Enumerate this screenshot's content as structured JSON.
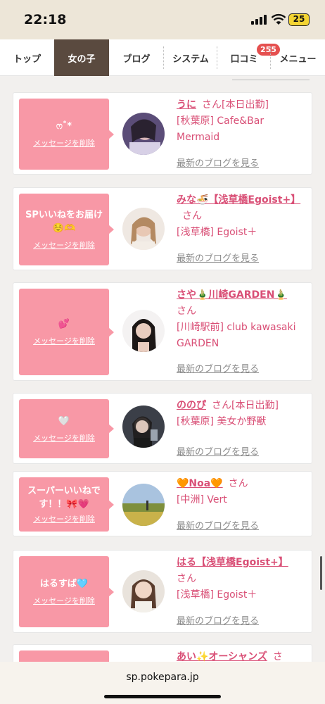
{
  "status_bar": {
    "time": "22:18",
    "battery": "25"
  },
  "nav": {
    "items": [
      {
        "label": "トップ"
      },
      {
        "label": "女の子"
      },
      {
        "label": "ブログ"
      },
      {
        "label": "システム"
      },
      {
        "label": "口コミ",
        "badge": "255"
      },
      {
        "label": "メニュー"
      }
    ],
    "active": "女の子"
  },
  "cards": [
    {
      "message": "ෆ˚*",
      "delete_label": "メッセージを削除",
      "name": "うに",
      "san": "さん",
      "status": "[本日出勤]",
      "shop": "[秋葉原] Cafe&Bar Mermaid",
      "blog_link": "最新のブログを見る"
    },
    {
      "message": "SPいいねをお届け☺️🫶",
      "delete_label": "メッセージを削除",
      "name": "みな🍜【浅草橋Egoist+】",
      "san": "さん",
      "status": "",
      "shop": "[浅草橋] Egoist＋",
      "blog_link": "最新のブログを見る"
    },
    {
      "message": "💕",
      "delete_label": "メッセージを削除",
      "name": "さや🎍川崎GARDEN🎍",
      "san": "さん",
      "status": "",
      "shop": "[川崎駅前] club kawasaki GARDEN",
      "blog_link": "最新のブログを見る"
    },
    {
      "message": "🤍",
      "delete_label": "メッセージを削除",
      "name": "ののぴ",
      "san": "さん",
      "status": "[本日出勤]",
      "shop": "[秋葉原] 美女か野獣",
      "blog_link": "最新のブログを見る"
    },
    {
      "message": "スーパーいいねです！！🎀💗",
      "delete_label": "メッセージを削除",
      "name": "🧡Noa🧡",
      "san": "さん",
      "status": "",
      "shop": "[中洲] Vert",
      "blog_link": "最新のブログを見る"
    },
    {
      "message": "はるすば🩵",
      "delete_label": "メッセージを削除",
      "name": "はる【浅草橋Egoist+】",
      "san": "さん",
      "status": "",
      "shop": "[浅草橋] Egoist＋",
      "blog_link": "最新のブログを見る"
    },
    {
      "message": "",
      "delete_label": "",
      "name": "あい✨オーシャンズ",
      "san": "さ",
      "status": "",
      "shop": "",
      "blog_link": ""
    }
  ],
  "url_bar": {
    "url": "sp.pokepara.jp"
  }
}
